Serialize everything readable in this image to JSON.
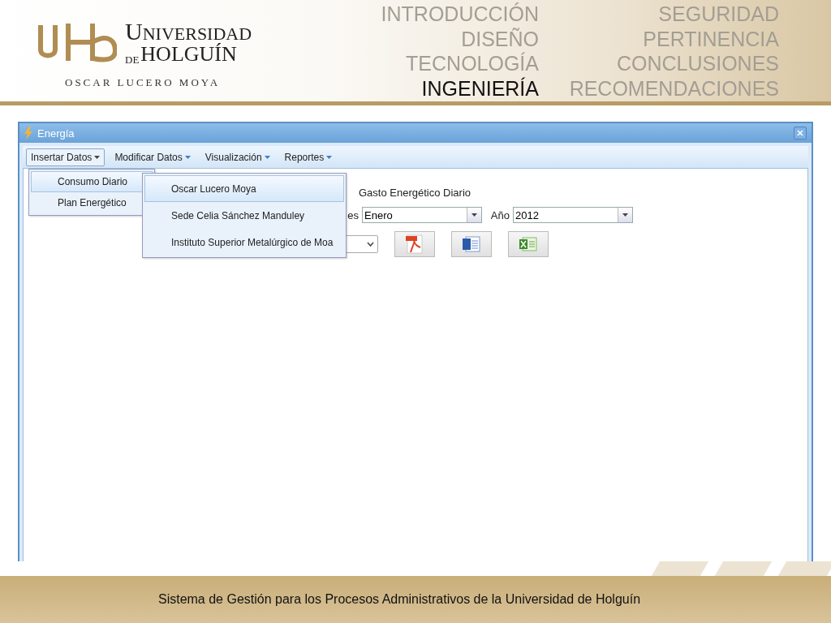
{
  "header": {
    "logo": {
      "name_line1": "UNIVERSIDAD",
      "name_prefix": "DE",
      "name_line2": "HOLGUÍN",
      "subtitle": "OSCAR LUCERO MOYA"
    },
    "nav": [
      {
        "items": [
          {
            "label": "INTRODUCCIÓN",
            "selected": false
          },
          {
            "label": "DISEÑO",
            "selected": false
          },
          {
            "label": "TECNOLOGÍA",
            "selected": false
          },
          {
            "label": "INGENIERÍA",
            "selected": true
          }
        ]
      },
      {
        "items": [
          {
            "label": "SEGURIDAD",
            "selected": false
          },
          {
            "label": "PERTINENCIA",
            "selected": false
          },
          {
            "label": "CONCLUSIONES",
            "selected": false
          },
          {
            "label": "RECOMENDACIONES",
            "selected": false
          }
        ]
      }
    ]
  },
  "window": {
    "title": "Energía",
    "menubar": [
      {
        "label": "Insertar Datos",
        "selected": true
      },
      {
        "label": "Modificar Datos",
        "selected": false
      },
      {
        "label": "Visualización",
        "selected": false
      },
      {
        "label": "Reportes",
        "selected": false
      }
    ],
    "dropdown": [
      {
        "label": "Consumo Diario",
        "highlighted": true
      },
      {
        "label": "Plan Energético",
        "highlighted": false
      }
    ],
    "submenu": [
      {
        "label": "Oscar Lucero Moya",
        "highlighted": true
      },
      {
        "label": "Sede Celia Sánchez Manduley",
        "highlighted": false
      },
      {
        "label": "Instituto Superior Metalúrgico de Moa",
        "highlighted": false
      }
    ],
    "form": {
      "title": "Gasto Energético Diario",
      "fields": [
        {
          "label": "es",
          "value": "Enero"
        },
        {
          "label": "Año",
          "value": "2012"
        }
      ],
      "export_buttons": [
        {
          "kind": "pdf"
        },
        {
          "kind": "word"
        },
        {
          "kind": "excel"
        }
      ]
    }
  },
  "footer": {
    "text": "Sistema de Gestión para los Procesos Administrativos de la Universidad de Holguín"
  }
}
